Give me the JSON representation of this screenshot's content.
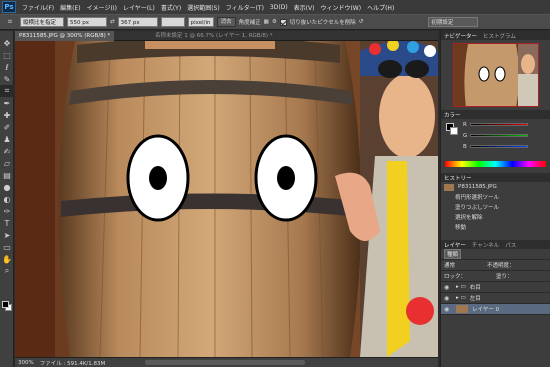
{
  "menubar": {
    "logo": "Ps",
    "items": [
      "ファイル(F)",
      "編集(E)",
      "イメージ(I)",
      "レイヤー(L)",
      "書式(Y)",
      "選択範囲(S)",
      "フィルター(T)",
      "3D(D)",
      "表示(V)",
      "ウィンドウ(W)",
      "ヘルプ(H)"
    ]
  },
  "options": {
    "ratio_select": "縦横比を指定",
    "width_value": "550 px",
    "height_value": "367 px",
    "resolution_unit": "pixel/in",
    "clear_button": "消去",
    "straighten_label": "角度補正",
    "delete_cropped_label": "切り抜いたピクセルを削除",
    "workspace": "初期設定"
  },
  "document": {
    "active_tab": "P8311585.JPG @ 300% (RGB/8) *",
    "inactive_tab": "名称未設定 1 @ 66.7% (レイヤー 1, RGB/8) *"
  },
  "status": {
    "zoom": "300%",
    "file_info": "ファイル : 591.4K/1.83M"
  },
  "panels": {
    "navigator_tab": "ナビゲーター",
    "histogram_tab": "ヒストグラム",
    "color_tab": "カラー",
    "color_r": "R",
    "color_g": "G",
    "color_b": "B",
    "history_tab": "ヒストリー",
    "history_items": [
      "P8311585.JPG",
      "楕円形選択ツール",
      "塗りつぶしツール",
      "選択を解除",
      "移動"
    ],
    "layers_tab": "レイヤー",
    "channels_tab": "チャンネル",
    "paths_tab": "パス",
    "layer_kind": "種類",
    "blend_mode": "通常",
    "opacity_label": "不透明度：",
    "lock_label": "ロック：",
    "fill_label": "塗り：",
    "layers": [
      "右目",
      "左目",
      "レイヤー 0"
    ]
  },
  "tools": [
    "move-tool",
    "marquee-tool",
    "lasso-tool",
    "quick-select-tool",
    "crop-tool",
    "eyedropper-tool",
    "healing-tool",
    "brush-tool",
    "clone-stamp-tool",
    "history-brush-tool",
    "eraser-tool",
    "gradient-tool",
    "blur-tool",
    "dodge-tool",
    "pen-tool",
    "type-tool",
    "path-select-tool",
    "shape-tool",
    "hand-tool",
    "zoom-tool"
  ]
}
